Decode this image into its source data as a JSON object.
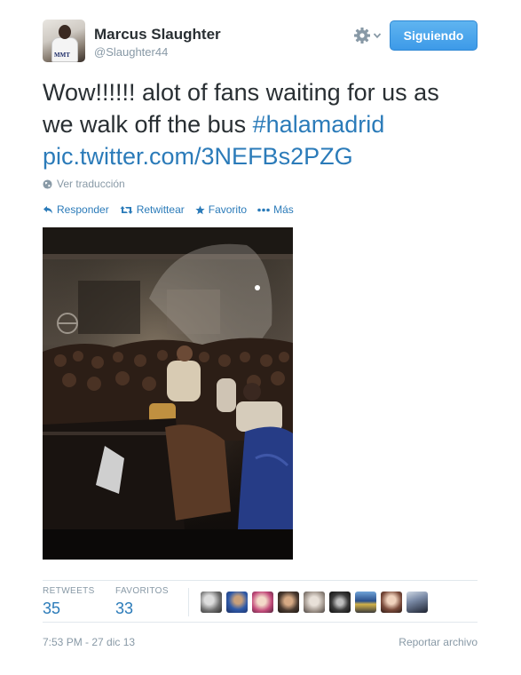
{
  "user": {
    "name": "Marcus Slaughter",
    "handle": "@Slaughter44",
    "avatar_tag": "MMT"
  },
  "controls": {
    "gear_icon": "gear-icon",
    "follow_label": "Siguiendo"
  },
  "tweet": {
    "text": "Wow!!!!!! alot of fans waiting for us as we walk off the bus ",
    "hashtag": "#halamadrid",
    "link": "pic.twitter.com/3NEFBs2PZG"
  },
  "translate_label": "Ver traducción",
  "actions": {
    "reply": "Responder",
    "retweet": "Retwittear",
    "favorite": "Favorito",
    "more": "Más"
  },
  "stats": {
    "retweets_label": "RETWEETS",
    "retweets_count": "35",
    "favorites_label": "FAVORITOS",
    "favorites_count": "33"
  },
  "timestamp": "7:53 PM - 27 dic 13",
  "report_label": "Reportar archivo",
  "colors": {
    "link": "#2b7bb9",
    "follow_button": "#3d9ae8",
    "muted": "#8899a6"
  }
}
